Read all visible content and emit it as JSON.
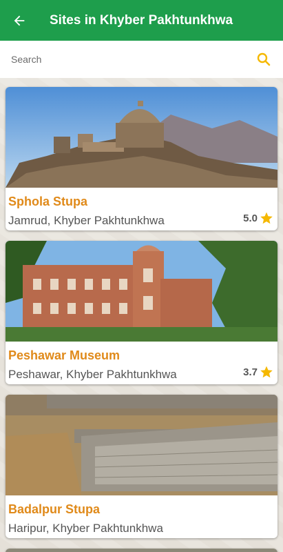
{
  "header": {
    "title": "Sites in Khyber Pakhtunkhwa",
    "back_icon": "arrow-left-icon"
  },
  "search": {
    "placeholder": "Search",
    "value": "",
    "icon": "search-icon"
  },
  "colors": {
    "app_bar": "#1e9e4c",
    "title_accent": "#e08a1a",
    "star": "#f5b800"
  },
  "sites": [
    {
      "name": "Sphola Stupa",
      "location": "Jamrud, Khyber Pakhtunkhwa",
      "rating": "5.0",
      "image": "stupa-on-hill"
    },
    {
      "name": "Peshawar Museum",
      "location": "Peshawar, Khyber Pakhtunkhwa",
      "rating": "3.7",
      "image": "museum-building"
    },
    {
      "name": "Badalpur Stupa",
      "location": "Haripur, Khyber Pakhtunkhwa",
      "rating": null,
      "image": "stone-ruins"
    }
  ]
}
